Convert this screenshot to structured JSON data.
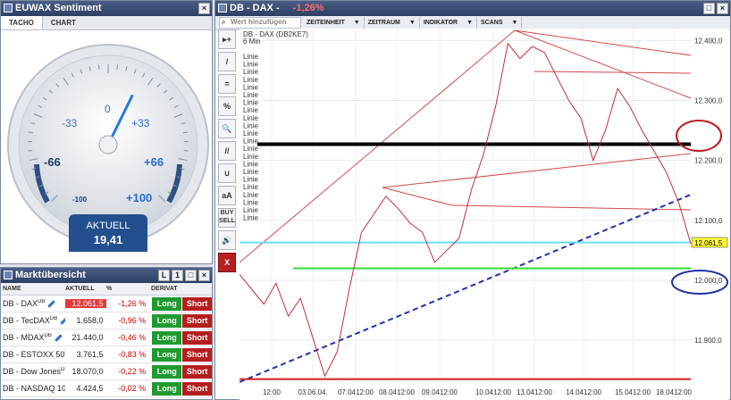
{
  "sentiment": {
    "title": "EUWAX Sentiment",
    "tabs": [
      "TACHO",
      "CHART"
    ],
    "gauge": {
      "labels": [
        "-100",
        "-66",
        "-33",
        "0",
        "+33",
        "+66",
        "+100"
      ],
      "value": 19.41,
      "value_label": "19,41",
      "caption": "AKTUELL",
      "range": [
        -100,
        100
      ]
    }
  },
  "market": {
    "title": "Marktübersicht",
    "headers": [
      "NAME",
      "AKTUELL",
      "%",
      "DERIVAT"
    ],
    "long_label": "Long",
    "short_label": "Short",
    "rows": [
      {
        "name": "DB - DAX",
        "sup": "DB",
        "value": "12.061,5",
        "pct": "-1,26 %",
        "highlight": true
      },
      {
        "name": "DB - TecDAX",
        "sup": "DB",
        "value": "1.658,0",
        "pct": "-0,96 %",
        "highlight": false
      },
      {
        "name": "DB - MDAX",
        "sup": "DB",
        "value": "21.440,0",
        "pct": "-0,46 %",
        "highlight": false
      },
      {
        "name": "DB - ESTOXX 50",
        "sup": "DB",
        "value": "3.761,5",
        "pct": "-0,83 %",
        "highlight": false
      },
      {
        "name": "DB - Dow Jones",
        "sup": "DB",
        "value": "18.070,0",
        "pct": "-0,22 %",
        "highlight": false
      },
      {
        "name": "DB - NASDAQ 100",
        "sup": "",
        "value": "4.424,5",
        "pct": "-0,02 %",
        "highlight": false
      }
    ]
  },
  "chart_window": {
    "title": "DB - DAX -",
    "change": "-1,26%",
    "search_placeholder": "Wert hinzufügen",
    "menu": [
      "ZEITEINHEIT",
      "ZEITRAUM",
      "INDIKATOR",
      "SCANS"
    ],
    "tools": [
      "▸+",
      "/",
      "=",
      "%",
      "🔍",
      "//",
      "∪",
      "aA",
      "BUY SELL",
      "🔊",
      "X"
    ],
    "colors": {
      "accent": "#2d3f62",
      "long": "#1f9a2f",
      "short": "#b51e1e"
    }
  },
  "chart_data": {
    "type": "line",
    "title": "DB - DAX (DB2KE7)",
    "subtitle": "6 Min",
    "line_labels": [
      "Linie",
      "Linie",
      "Linie",
      "Linie",
      "Linie",
      "Linie",
      "Linie",
      "Linie",
      "Linie",
      "Linie",
      "Linie",
      "Linie",
      "Linie",
      "Linie",
      "Linie",
      "Linie",
      "Linie",
      "Linie",
      "Linie",
      "Linie",
      "Linie",
      "Linie"
    ],
    "y_ticks": [
      "12.400,0",
      "12.300,0",
      "12.200,0",
      "12.100,0",
      "12.000,0",
      "11.900,0"
    ],
    "x_ticks": [
      "12:00",
      "03.06.04.",
      "07.0412:00",
      "08.0412:00",
      "09.0412:00",
      "10.0412:00",
      "13.0412:00",
      "14.0412:00",
      "15.0412:00",
      "18.0412:00"
    ],
    "ylim": [
      11830,
      12420
    ],
    "last_value": "12.061,5",
    "series": [
      {
        "values": [
          12010,
          11985,
          11960,
          11995,
          11940,
          11970,
          11905,
          11840,
          11880,
          11985,
          12080,
          12110,
          12140,
          12120,
          12095,
          12080,
          12030,
          12050,
          12070,
          12150,
          12210,
          12290,
          12395,
          12370,
          12390,
          12380,
          12340,
          12300,
          12270,
          12200,
          12250,
          12320,
          12290,
          12250,
          12215,
          12180,
          12130,
          12061
        ]
      }
    ],
    "horizontal_lines": [
      {
        "y": 12227,
        "color": "#000000"
      },
      {
        "y": 12063,
        "color": "#66e0f0"
      },
      {
        "y": 12020,
        "color": "#33dd33"
      },
      {
        "y": 11835,
        "color": "#d02020"
      }
    ]
  }
}
